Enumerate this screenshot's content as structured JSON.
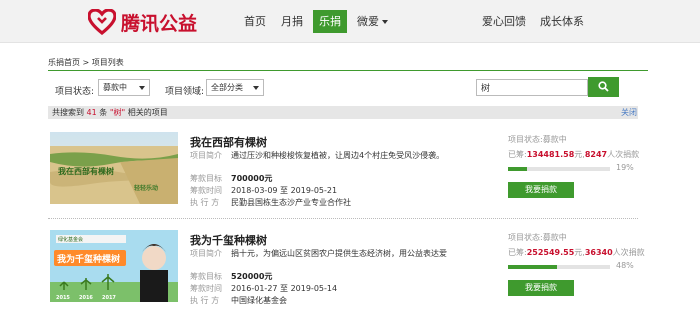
{
  "brand": {
    "name": "腾讯公益",
    "color": "#c8102e",
    "accent": "#3f9a2e"
  },
  "nav": {
    "items": [
      {
        "label": "首页"
      },
      {
        "label": "月捐"
      },
      {
        "label": "乐捐",
        "active": true
      },
      {
        "label": "微爱",
        "dropdown": true
      },
      {
        "label": "爱心回馈"
      },
      {
        "label": "成长体系"
      }
    ]
  },
  "breadcrumb": {
    "text": "乐捐首页 > 项目列表"
  },
  "filters": {
    "status_label": "项目状态:",
    "status_value": "募款中",
    "field_label": "项目领域:",
    "field_value": "全部分类",
    "search_value": "树",
    "search_icon": "search-icon"
  },
  "results": {
    "prefix": "共搜索到",
    "count": "41",
    "mid": "条",
    "keyword": "\"树\"",
    "suffix": "相关的项目",
    "close_label": "关闭"
  },
  "projects": [
    {
      "title": "我在西部有棵树",
      "summary_label": "项目简介",
      "summary": "通过压沙和种梭梭恢复植被，让周边4个村庄免受风沙侵袭。",
      "target_label": "筹款目标",
      "target": "700000元",
      "time_label": "筹款时间",
      "time": "2018-03-09 至 2019-05-21",
      "exec_label": "执 行 方",
      "executor": "民勤县国栋生态沙产业专业合作社",
      "status_text": "项目状态:募款中",
      "raised_prefix": "已筹:",
      "raised": "134481.58",
      "raised_unit": "元,",
      "donors": "8247",
      "donors_suffix": "人次捐款",
      "progress": 19,
      "progress_label": "19%",
      "button": "我要捐款",
      "image_text": "我在西部有棵树"
    },
    {
      "title": "我为千玺种棵树",
      "summary_label": "项目简介",
      "summary": "捐十元，为偏远山区贫困农户提供生态经济树，用公益表达爱",
      "target_label": "筹款目标",
      "target": "520000元",
      "time_label": "筹款时间",
      "time": "2016-01-27 至 2019-05-14",
      "exec_label": "执 行 方",
      "executor": "中国绿化基金会",
      "status_text": "项目状态:募款中",
      "raised_prefix": "已筹:",
      "raised": "252549.55",
      "raised_unit": "元,",
      "donors": "36340",
      "donors_suffix": "人次捐款",
      "progress": 48,
      "progress_label": "48%",
      "button": "我要捐款",
      "image_text": "我为千玺种棵树",
      "image_years": [
        "2015",
        "2016",
        "2017"
      ]
    }
  ]
}
